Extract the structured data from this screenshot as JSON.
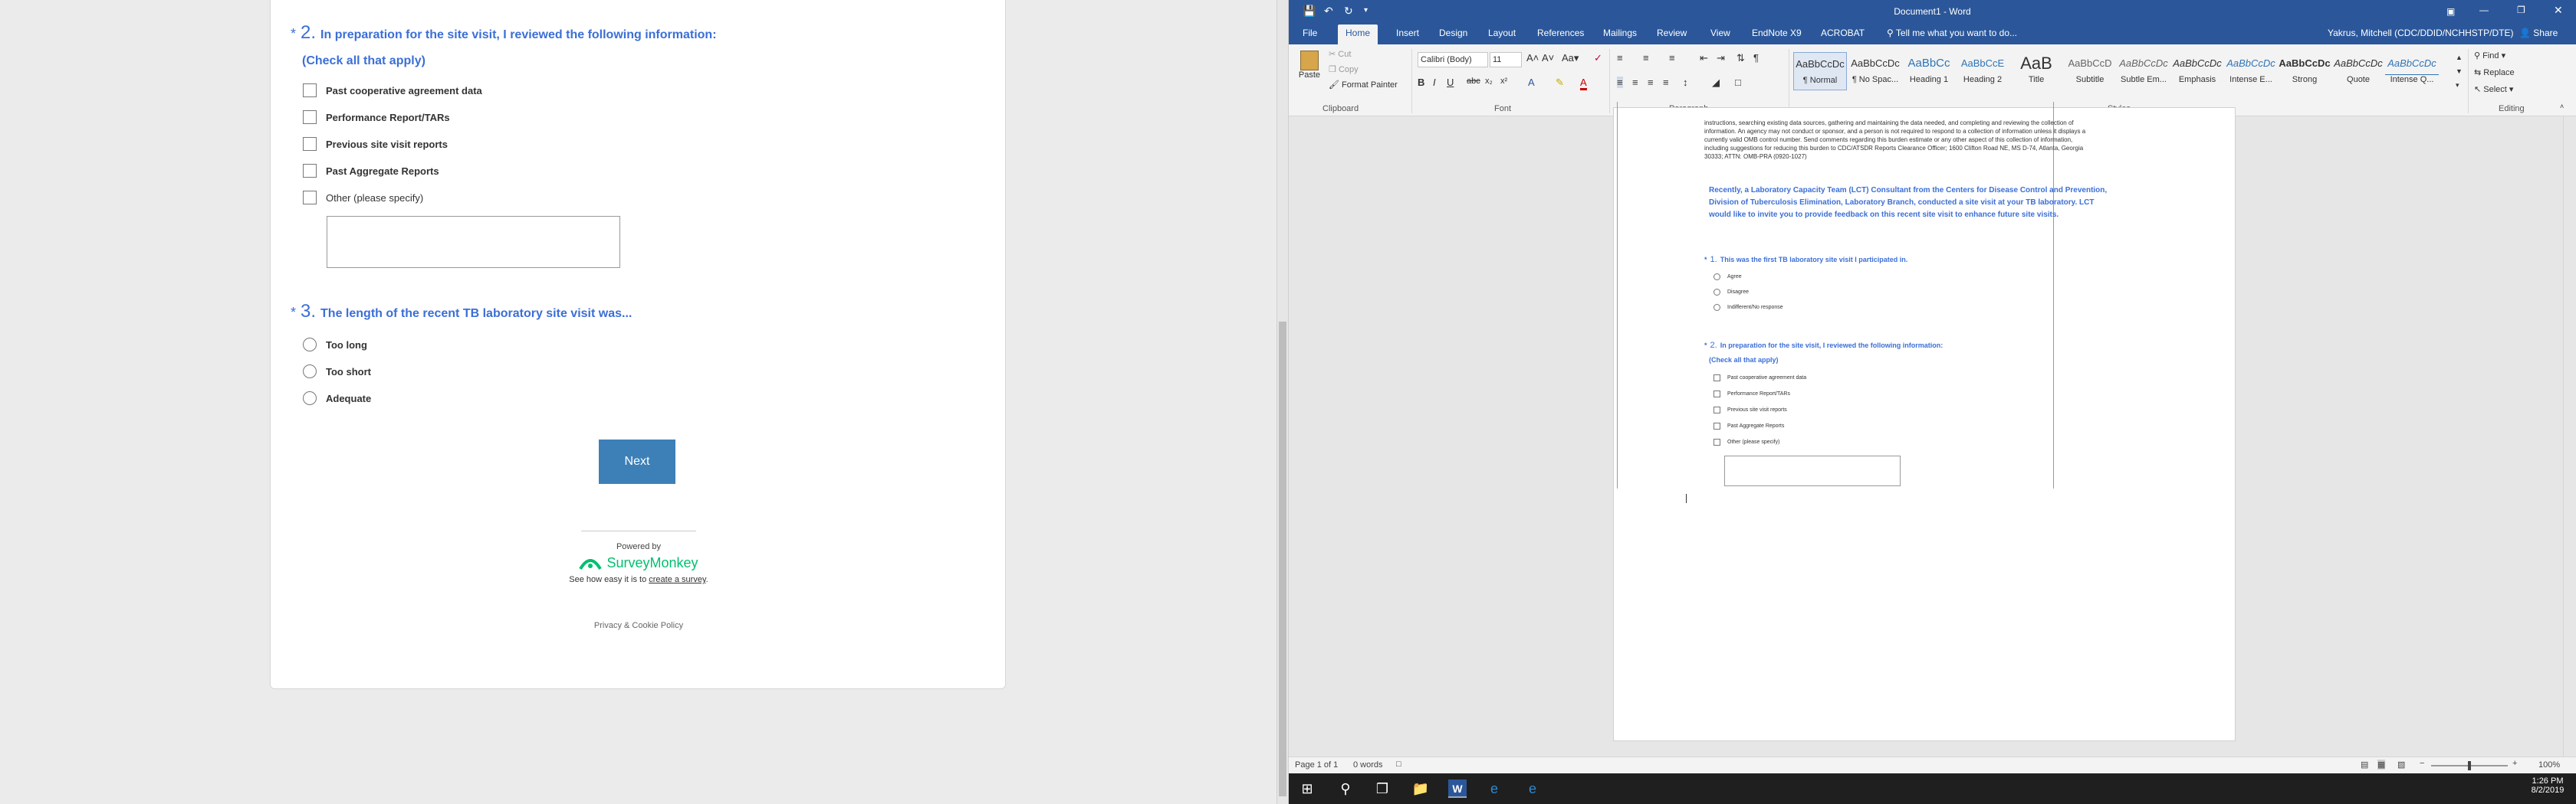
{
  "survey": {
    "q2": {
      "asterisk": "*",
      "number": "2.",
      "text": "In preparation for the site visit, I reviewed the following information:",
      "subtext": "(Check all that apply)",
      "options": [
        "Past cooperative agreement data",
        "Performance Report/TARs",
        "Previous site visit reports",
        "Past Aggregate Reports",
        "Other (please specify)"
      ]
    },
    "q3": {
      "asterisk": "*",
      "number": "3.",
      "text": "The length of the recent TB laboratory site visit was...",
      "options": [
        "Too long",
        "Too short",
        "Adequate"
      ]
    },
    "next_label": "Next",
    "powered_by": "Powered by",
    "brand": "SurveyMonkey",
    "see_how": "See how easy it is to",
    "create_link": "create a survey",
    "period": ".",
    "privacy": "Privacy & Cookie Policy"
  },
  "word": {
    "title": "Document1 - Word",
    "user": "Yakrus, Mitchell (CDC/DDID/NCHHSTP/DTE)",
    "share": "Share",
    "tabs": [
      "File",
      "Home",
      "Insert",
      "Design",
      "Layout",
      "References",
      "Mailings",
      "Review",
      "View",
      "EndNote X9",
      "ACROBAT"
    ],
    "tell_me": "Tell me what you want to do...",
    "clipboard": {
      "paste": "Paste",
      "cut": "Cut",
      "copy": "Copy",
      "format_painter": "Format Painter",
      "label": "Clipboard"
    },
    "font": {
      "name": "Calibri (Body)",
      "size": "11",
      "label": "Font"
    },
    "paragraph_label": "Paragraph",
    "styles_label": "Styles",
    "styles": [
      {
        "preview": "AaBbCcDc",
        "name": "¶ Normal"
      },
      {
        "preview": "AaBbCcDc",
        "name": "¶ No Spac..."
      },
      {
        "preview": "AaBbCc",
        "name": "Heading 1"
      },
      {
        "preview": "AaBbCcE",
        "name": "Heading 2"
      },
      {
        "preview": "AaB",
        "name": "Title"
      },
      {
        "preview": "AaBbCcD",
        "name": "Subtitle"
      },
      {
        "preview": "AaBbCcDc",
        "name": "Subtle Em..."
      },
      {
        "preview": "AaBbCcDc",
        "name": "Emphasis"
      },
      {
        "preview": "AaBbCcDc",
        "name": "Intense E..."
      },
      {
        "preview": "AaBbCcDc",
        "name": "Strong"
      },
      {
        "preview": "AaBbCcDc",
        "name": "Quote"
      },
      {
        "preview": "AaBbCcDc",
        "name": "Intense Q..."
      }
    ],
    "editing": {
      "find": "Find",
      "replace": "Replace",
      "select": "Select",
      "label": "Editing"
    },
    "doc": {
      "burden": [
        "instructions, searching existing data sources, gathering and maintaining the data needed, and completing and reviewing the collection of",
        "information.  An agency may not conduct or sponsor, and a person is not required to respond to a collection of information unless it displays a",
        "currently valid OMB control number.  Send comments regarding this burden estimate or any other aspect of this collection of information,",
        "including suggestions for reducing this burden to CDC/ATSDR Reports Clearance Officer; 1600 Clifton Road NE, MS D-74, Atlanta, Georgia",
        "30333; ATTN: OMB-PRA (0920-1027)"
      ],
      "intro": "Recently, a Laboratory Capacity Team (LCT) Consultant from the Centers for Disease Control and Prevention, Division of Tuberculosis Elimination, Laboratory Branch, conducted a site visit at your TB laboratory. LCT would like to invite you to provide feedback on this recent site visit to enhance future site visits.",
      "q1": {
        "asterisk": "*",
        "number": "1.",
        "text": "This was the first TB laboratory site visit I participated in.",
        "options": [
          "Agree",
          "Disagree",
          "Indifferent/No response"
        ]
      },
      "q2": {
        "asterisk": "*",
        "number": "2.",
        "text": "In preparation for the site visit, I reviewed the following information:",
        "subtext": "(Check all that apply)",
        "options": [
          "Past cooperative agreement data",
          "Performance Report/TARs",
          "Previous site visit reports",
          "Past Aggregate Reports",
          "Other (please specify)"
        ]
      }
    },
    "status": {
      "page": "Page 1 of 1",
      "words": "0 words",
      "zoom": "100%"
    }
  },
  "taskbar": {
    "time": "1:26 PM",
    "date": "8/2/2019"
  }
}
